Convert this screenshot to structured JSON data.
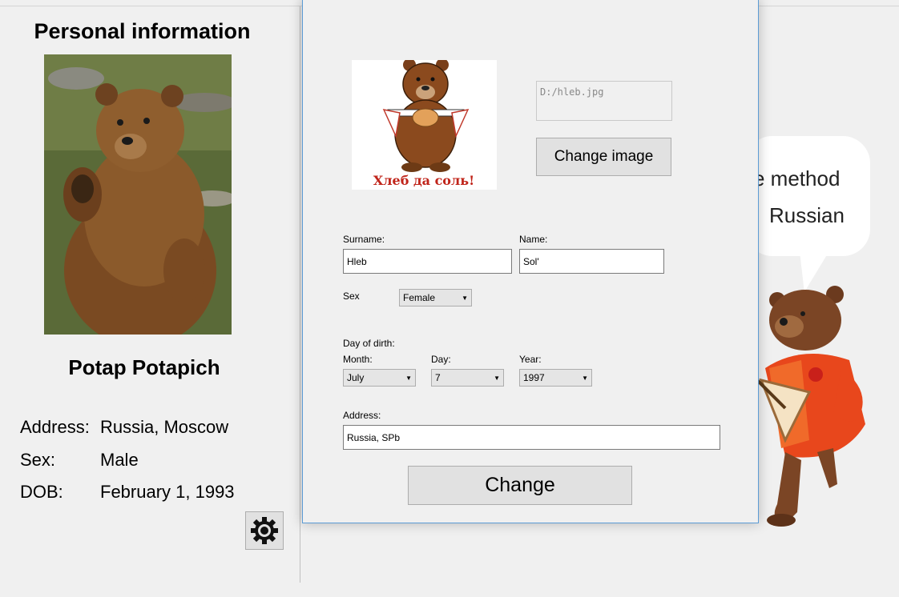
{
  "profile": {
    "title": "Personal information",
    "full_name": "Potap Potapich",
    "address_label": "Address:",
    "address_value": "Russia, Moscow",
    "sex_label": "Sex:",
    "sex_value": "Male",
    "dob_label": "DOB:",
    "dob_value": "February 1, 1993",
    "settings_icon": "gear-icon"
  },
  "bubble": {
    "line1": "e method",
    "line2": "Russian"
  },
  "dialog": {
    "image_caption": "Хлеб да соль!",
    "image_path": "D:/hleb.jpg",
    "change_image_label": "Change image",
    "surname_label": "Surname:",
    "surname_value": "Hleb",
    "name_label": "Name:",
    "name_value": "Sol'",
    "sex_label": "Sex",
    "sex_value": "Female",
    "dob_label": "Day of dirth:",
    "month_label": "Month:",
    "month_value": "July",
    "day_label": "Day:",
    "day_value": "7",
    "year_label": "Year:",
    "year_value": "1997",
    "address_label": "Address:",
    "address_value": "Russia, SPb",
    "submit_label": "Change"
  }
}
